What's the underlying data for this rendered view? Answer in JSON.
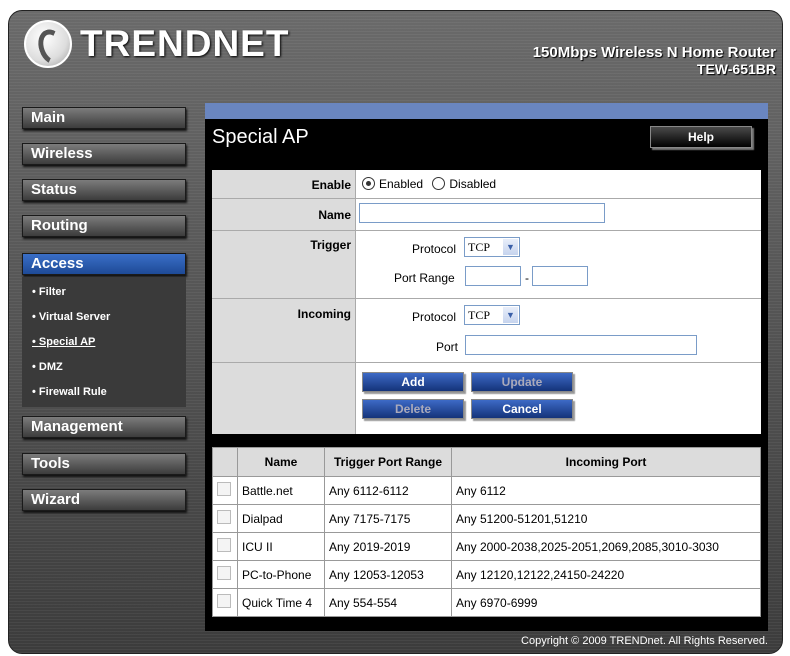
{
  "header": {
    "brand": "TRENDNET",
    "product_line1": "150Mbps Wireless N Home Router",
    "product_line2": "TEW-651BR"
  },
  "sidebar": {
    "main": "Main",
    "wireless": "Wireless",
    "status": "Status",
    "routing": "Routing",
    "access": "Access",
    "access_items": [
      "Filter",
      "Virtual Server",
      "Special AP",
      "DMZ",
      "Firewall Rule"
    ],
    "management": "Management",
    "tools": "Tools",
    "wizard": "Wizard"
  },
  "page": {
    "title": "Special AP",
    "help": "Help"
  },
  "form": {
    "enable_label": "Enable",
    "enabled": "Enabled",
    "disabled": "Disabled",
    "enable_value": "Enabled",
    "name_label": "Name",
    "name_value": "",
    "trigger_label": "Trigger",
    "protocol_label": "Protocol",
    "trigger_protocol": "TCP",
    "port_range_label": "Port Range",
    "port_range_sep": "-",
    "incoming_label": "Incoming",
    "incoming_protocol": "TCP",
    "port_label": "Port",
    "add": "Add",
    "update": "Update",
    "delete": "Delete",
    "cancel": "Cancel"
  },
  "table": {
    "headers": [
      "Name",
      "Trigger Port Range",
      "Incoming Port"
    ],
    "rows": [
      {
        "name": "Battle.net",
        "trigger": "Any 6112-6112",
        "incoming": "Any 6112"
      },
      {
        "name": "Dialpad",
        "trigger": "Any 7175-7175",
        "incoming": "Any 51200-51201,51210"
      },
      {
        "name": "ICU II",
        "trigger": "Any 2019-2019",
        "incoming": "Any 2000-2038,2025-2051,2069,2085,3010-3030"
      },
      {
        "name": "PC-to-Phone",
        "trigger": "Any 12053-12053",
        "incoming": "Any 12120,12122,24150-24220"
      },
      {
        "name": "Quick Time 4",
        "trigger": "Any 554-554",
        "incoming": "Any 6970-6999"
      }
    ]
  },
  "footer": {
    "copyright": "Copyright © 2009 TRENDnet. All Rights Reserved."
  }
}
